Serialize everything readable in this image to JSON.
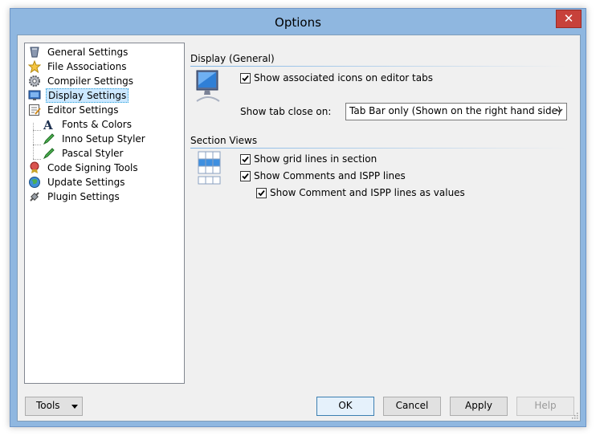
{
  "window": {
    "title": "Options",
    "close_label": "✕"
  },
  "tree": {
    "items": [
      {
        "label": "General Settings",
        "icon": "general-settings-icon"
      },
      {
        "label": "File Associations",
        "icon": "star-icon"
      },
      {
        "label": "Compiler Settings",
        "icon": "gear-icon"
      },
      {
        "label": "Display Settings",
        "icon": "monitor-icon",
        "selected": true
      },
      {
        "label": "Editor Settings",
        "icon": "editor-icon"
      },
      {
        "label": "Fonts & Colors",
        "icon": "font-icon"
      },
      {
        "label": "Inno Setup Styler",
        "icon": "pen-icon"
      },
      {
        "label": "Pascal Styler",
        "icon": "pen-icon"
      },
      {
        "label": "Code Signing Tools",
        "icon": "seal-icon"
      },
      {
        "label": "Update Settings",
        "icon": "globe-icon"
      },
      {
        "label": "Plugin Settings",
        "icon": "plug-icon"
      }
    ]
  },
  "display_general": {
    "title": "Display (General)",
    "show_icons": {
      "label": "Show associated icons on editor tabs",
      "checked": true
    },
    "tab_close_label": "Show tab close on:",
    "tab_close_value": "Tab Bar only (Shown on the right hand side)"
  },
  "section_views": {
    "title": "Section Views",
    "grid_lines": {
      "label": "Show grid lines in section",
      "checked": true
    },
    "comments": {
      "label": "Show Comments and ISPP lines",
      "checked": true
    },
    "comments_values": {
      "label": "Show Comment and ISPP lines as values",
      "checked": true
    }
  },
  "buttons": {
    "tools": "Tools",
    "ok": "OK",
    "cancel": "Cancel",
    "apply": "Apply",
    "help": "Help"
  },
  "colors": {
    "accent": "#26a0da",
    "selection": "#cce8ff",
    "close": "#c7413a"
  }
}
